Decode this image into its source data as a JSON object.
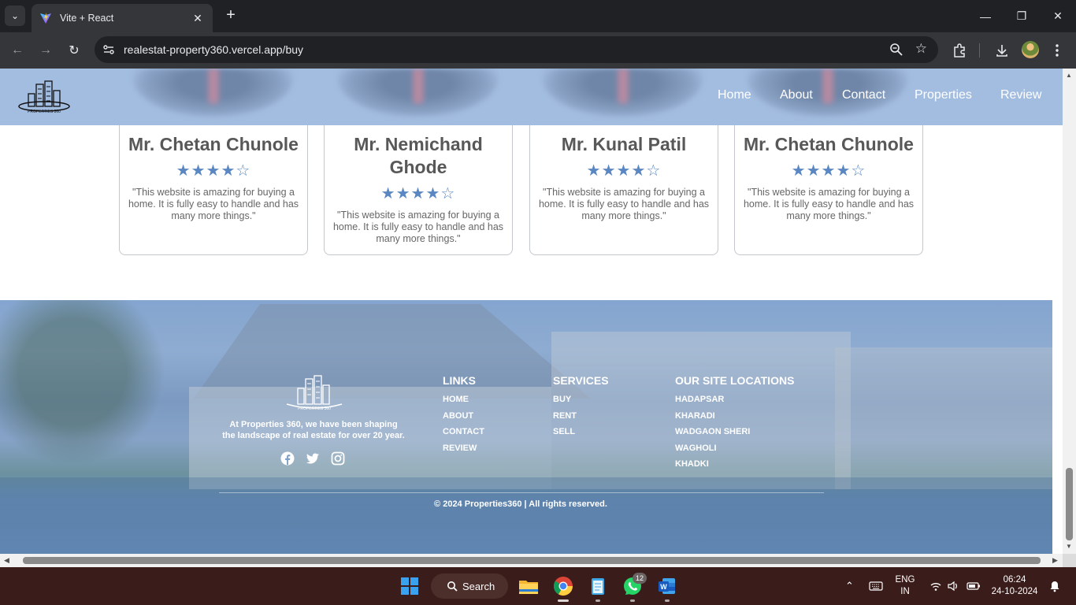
{
  "browser": {
    "tab_title": "Vite + React",
    "url": "realestat-property360.vercel.app/buy"
  },
  "site": {
    "nav": [
      "Home",
      "About",
      "Contact",
      "Properties",
      "Review"
    ],
    "logo_text": "PROPERTIES 360",
    "reviews": [
      {
        "name": "Mr. Chetan Chunole",
        "stars": "★★★★☆",
        "rating": 4,
        "quote": "\"This website is amazing for buying a home. It is fully easy to handle and has many more things.\""
      },
      {
        "name": "Mr. Nemichand Ghode",
        "stars": "★★★★☆",
        "rating": 4,
        "quote": "\"This website is amazing for buying a home. It is fully easy to handle and has many more things.\""
      },
      {
        "name": "Mr. Kunal Patil",
        "stars": "★★★★☆",
        "rating": 4,
        "quote": "\"This website is amazing for buying a home. It is fully easy to handle and has many more things.\""
      },
      {
        "name": "Mr. Chetan Chunole",
        "stars": "★★★★☆",
        "rating": 4,
        "quote": "\"This website is amazing for buying a home. It is fully easy to handle and has many more things.\""
      }
    ],
    "footer": {
      "about": "At Properties 360, we have been shaping the landscape of real estate for over 20 year.",
      "links_title": "LINKS",
      "links": [
        "HOME",
        "ABOUT",
        "CONTACT",
        "REVIEW"
      ],
      "services_title": "SERVICES",
      "services": [
        "BUY",
        "RENT",
        "SELL"
      ],
      "locations_title": "OUR SITE LOCATIONS",
      "locations": [
        "HADAPSAR",
        "KHARADI",
        "WADGAON SHERI",
        "WAGHOLI",
        "KHADKI"
      ],
      "copyright": "© 2024 Properties360 | All rights reserved."
    }
  },
  "taskbar": {
    "search_label": "Search",
    "whatsapp_badge": "12",
    "lang_line1": "ENG",
    "lang_line2": "IN",
    "time": "06:24",
    "date": "24-10-2024"
  },
  "colors": {
    "header_bg": "#a3bde0",
    "star_color": "#5a87c2",
    "footer_overlay": "#6e96cd"
  }
}
